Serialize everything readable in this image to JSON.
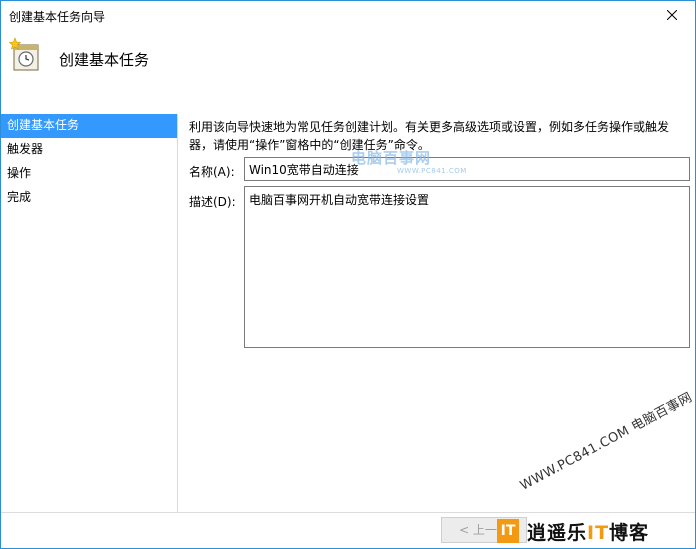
{
  "window": {
    "title": "创建基本任务向导"
  },
  "header": {
    "icon": "task-scheduler-icon",
    "title": "创建基本任务"
  },
  "sidebar": {
    "items": [
      {
        "label": "创建基本任务",
        "active": true
      },
      {
        "label": "触发器",
        "active": false
      },
      {
        "label": "操作",
        "active": false
      },
      {
        "label": "完成",
        "active": false
      }
    ]
  },
  "content": {
    "intro_line1": "利用该向导快速地为常见任务创建计划。有关更多高级选项或设置，例如多任务操作或触发",
    "intro_line2": "器，请使用“操作”窗格中的“创建任务”命令。",
    "name_label": "名称(A):",
    "name_value": "Win10宽带自动连接",
    "desc_label": "描述(D):",
    "desc_value": "电脑百事网开机自动宽带连接设置"
  },
  "footer": {
    "back_label": "< 上一步"
  },
  "watermarks": {
    "logo_text": "电脑百事网",
    "logo_url": "WWW.PC841.COM",
    "diagonal_text": "WWW.PC841.COM 电脑百事网",
    "blog_it": "IT",
    "blog_prefix": "逍遥乐",
    "blog_mid": "IT",
    "blog_suffix": "博客"
  },
  "colors": {
    "accent": "#3399ff",
    "border": "#2b8fd8",
    "orange": "#f39a12"
  }
}
